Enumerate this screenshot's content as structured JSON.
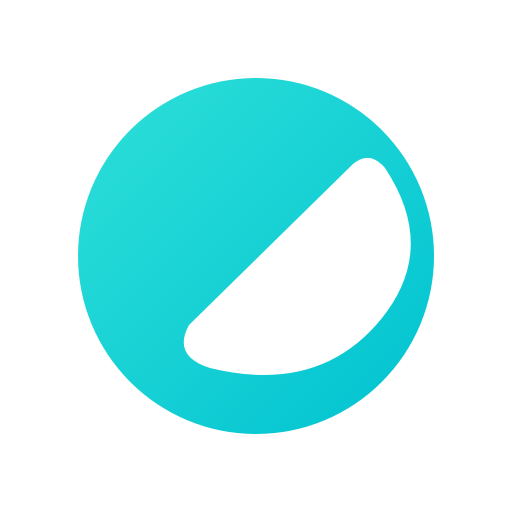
{
  "icon": {
    "name": "half-moon-contrast-icon",
    "colors": {
      "background": "#ffffff",
      "circle_gradient_start": "#2ee0d8",
      "circle_gradient_end": "#00c2d1",
      "inner_shape": "#ffffff"
    }
  }
}
